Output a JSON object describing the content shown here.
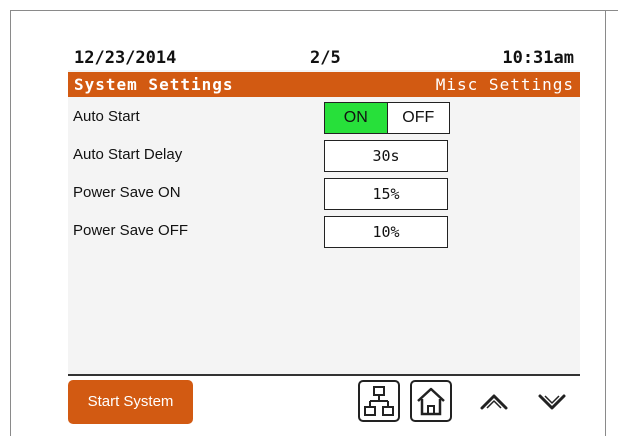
{
  "status": {
    "date": "12/23/2014",
    "page": "2/5",
    "time": "10:31am"
  },
  "header": {
    "title": "System Settings",
    "subtitle": "Misc Settings"
  },
  "settings": {
    "auto_start": {
      "label": "Auto Start",
      "on_label": "ON",
      "off_label": "OFF",
      "selected": "ON"
    },
    "auto_start_delay": {
      "label": "Auto Start Delay",
      "value": "30s"
    },
    "power_save_on": {
      "label": "Power Save ON",
      "value": "15%"
    },
    "power_save_off": {
      "label": "Power Save OFF",
      "value": "10%"
    }
  },
  "footer": {
    "start_label": "Start System",
    "icons": [
      "network-icon",
      "home-icon",
      "chevron-up-icon",
      "chevron-down-icon"
    ]
  },
  "colors": {
    "accent": "#d25a12",
    "on_green": "#27e03a"
  }
}
